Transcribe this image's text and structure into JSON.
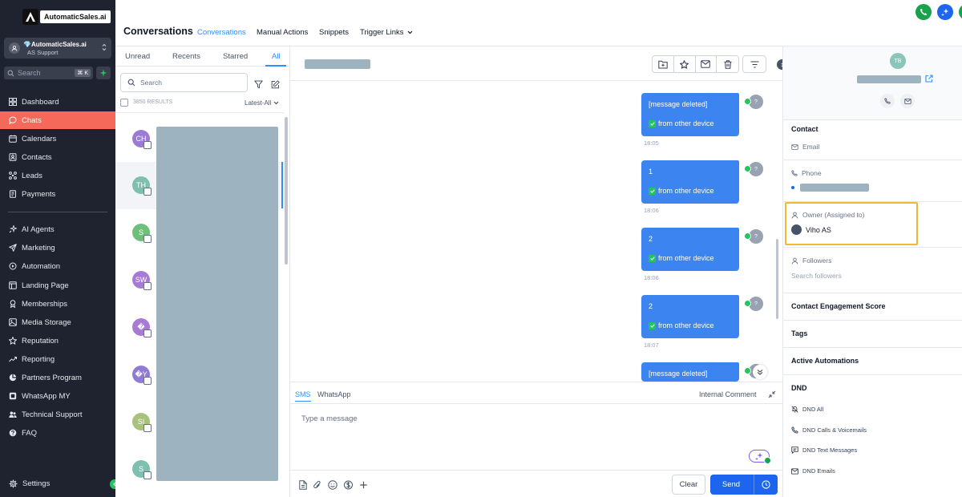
{
  "brand": {
    "name": "AutomaticSales.ai"
  },
  "account": {
    "name": "💎AutomaticSales.ai",
    "sub": "AS Support"
  },
  "sidebar_search": {
    "placeholder": "Search",
    "shortcut": "⌘ K"
  },
  "nav": {
    "items": [
      {
        "label": "Dashboard",
        "icon": "dashboard-icon"
      },
      {
        "label": "Chats",
        "icon": "chat-icon",
        "active": true
      },
      {
        "label": "Calendars",
        "icon": "calendar-icon"
      },
      {
        "label": "Contacts",
        "icon": "contacts-icon"
      },
      {
        "label": "Leads",
        "icon": "leads-icon"
      },
      {
        "label": "Payments",
        "icon": "payments-icon"
      },
      {
        "label": "AI Agents",
        "icon": "ai-agents-icon"
      },
      {
        "label": "Marketing",
        "icon": "marketing-icon"
      },
      {
        "label": "Automation",
        "icon": "automation-icon"
      },
      {
        "label": "Landing Page",
        "icon": "landing-page-icon"
      },
      {
        "label": "Memberships",
        "icon": "memberships-icon"
      },
      {
        "label": "Media Storage",
        "icon": "media-storage-icon"
      },
      {
        "label": "Reputation",
        "icon": "reputation-icon"
      },
      {
        "label": "Reporting",
        "icon": "reporting-icon"
      },
      {
        "label": "Partners Program",
        "icon": "partners-icon"
      },
      {
        "label": "WhatsApp MY",
        "icon": "whatsapp-icon"
      },
      {
        "label": "Technical Support",
        "icon": "support-icon"
      },
      {
        "label": "FAQ",
        "icon": "faq-icon"
      }
    ],
    "settings": "Settings"
  },
  "header": {
    "title": "Conversations",
    "tabs": [
      "Conversations",
      "Manual Actions",
      "Snippets",
      "Trigger Links"
    ]
  },
  "list": {
    "tabs": [
      "Unread",
      "Recents",
      "Starred",
      "All"
    ],
    "search_placeholder": "Search",
    "results": "3850 RESULTS",
    "sort": "Latest-All",
    "rows": [
      {
        "initials": "CH",
        "color": "#9b7bd4"
      },
      {
        "initials": "TH",
        "color": "#7fbfb0"
      },
      {
        "initials": "S",
        "color": "#6dbf7b"
      },
      {
        "initials": "SW",
        "color": "#a77bd4"
      },
      {
        "initials": "�",
        "color": "#a77bd4"
      },
      {
        "initials": "�Y",
        "color": "#8f7bd4"
      },
      {
        "initials": "SI",
        "color": "#a8c17b"
      },
      {
        "initials": "S",
        "color": "#7fbfb0"
      }
    ]
  },
  "chat": {
    "messages": [
      {
        "text": "[message deleted]",
        "device": "from other device",
        "time": "18:05"
      },
      {
        "text": "1",
        "device": "from other device",
        "time": "18:06"
      },
      {
        "text": "2",
        "device": "from other device",
        "time": "18:06"
      },
      {
        "text": "2",
        "device": "from other device",
        "time": "18:07"
      },
      {
        "text": "[message deleted]",
        "device": "",
        "time": ""
      }
    ],
    "sender_initial": "?",
    "composer": {
      "tabs": [
        "SMS",
        "WhatsApp"
      ],
      "internal": "Internal Comment",
      "placeholder": "Type a message",
      "clear": "Clear",
      "send": "Send"
    }
  },
  "contact": {
    "initials": "TB",
    "section_contact": "Contact",
    "email_label": "Email",
    "phone_label": "Phone",
    "owner_label": "Owner (Assigned to)",
    "owner_value": "Viho AS",
    "followers_label": "Followers",
    "followers_placeholder": "Search followers",
    "engagement": "Contact Engagement Score",
    "tags": "Tags",
    "automations": "Active Automations",
    "dnd": "DND",
    "dnd_items": [
      "DND All",
      "DND Calls & Voicemails",
      "DND Text Messages",
      "DND Emails"
    ]
  },
  "colors": {
    "accent": "#2e90fa",
    "active_nav": "#f4695a",
    "send": "#1d64ef",
    "highlight": "#f0b932"
  }
}
